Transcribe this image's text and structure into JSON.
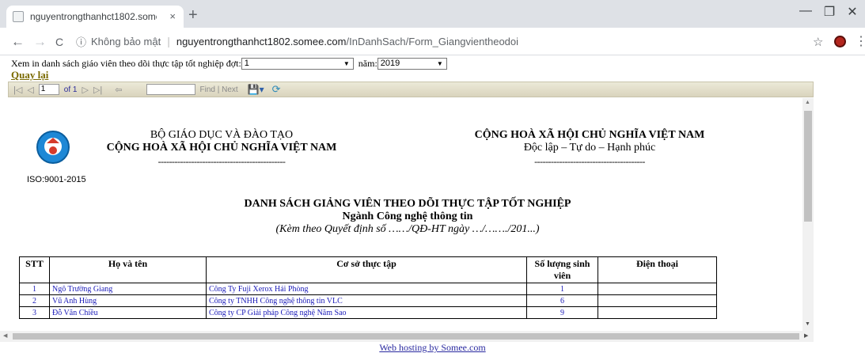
{
  "browser": {
    "tab_title": "nguyentrongthanhct1802.somee",
    "tab_close": "×",
    "new_tab": "+",
    "win_minimize": "—",
    "win_maximize": "❐",
    "win_close": "✕",
    "back": "←",
    "forward": "→",
    "reload": "C",
    "security_icon": "ⓘ",
    "security_label": "Không bảo mật",
    "separator": "|",
    "url_host": "nguyentrongthanhct1802.somee.com",
    "url_path": "/InDanhSach/Form_Giangvientheodoi",
    "star": "☆",
    "menu": "⋮"
  },
  "filter": {
    "label_dot": "Xem in danh sách giáo viên theo dõi thực tập tốt nghiệp đợt:",
    "dot_value": "1",
    "label_year": "năm:",
    "year_value": "2019",
    "arrow": "▼"
  },
  "back_link": "Quay lại",
  "report_toolbar": {
    "first": "|◁",
    "prev": "◁",
    "page_value": "1",
    "of_pages": "of 1",
    "next": "▷",
    "last": "▷|",
    "back_nav": "⇦",
    "find_label": "Find",
    "find_sep": "|",
    "next_label": "Next",
    "export_icon": "💾▾",
    "refresh_icon": "⟳"
  },
  "report": {
    "iso": "ISO:9001-2015",
    "header_left": {
      "line1": "BỘ GIÁO DỤC VÀ ĐÀO TẠO",
      "line2": "CỘNG HOÀ XÃ HỘI CHỦ NGHĨA VIỆT NAM",
      "dashes": "----------------------------------------------"
    },
    "header_right": {
      "line1": "CỘNG HOÀ XÃ HỘI CHỦ NGHĨA VIỆT NAM",
      "line2": "Độc lập – Tự do – Hạnh phúc",
      "dashes": "----------------------------------------"
    },
    "title": "DANH SÁCH GIẢNG VIÊN THEO DÕI THỰC TẬP TỐT NGHIỆP",
    "subtitle": "Ngành Công nghệ thông tin",
    "note": "(Kèm theo Quyết định số ……/QĐ-HT ngày …/……./201...)",
    "columns": [
      "STT",
      "Họ và tên",
      "Cơ sở thực tập",
      "Số lượng sinh viên",
      "Điện thoại"
    ],
    "rows": [
      {
        "stt": "1",
        "name": "Ngô Trường Giang",
        "place": "Công Ty Fuji Xerox Hải Phòng",
        "count": "1",
        "phone": ""
      },
      {
        "stt": "2",
        "name": "Vũ Anh Hùng",
        "place": "Công ty TNHH Công nghệ thông tin VLC",
        "count": "6",
        "phone": ""
      },
      {
        "stt": "3",
        "name": "Đỗ Văn Chiều",
        "place": "Công ty CP Giải pháp Công nghệ Năm Sao",
        "count": "9",
        "phone": ""
      }
    ]
  },
  "footer": "Web hosting by Somee.com"
}
